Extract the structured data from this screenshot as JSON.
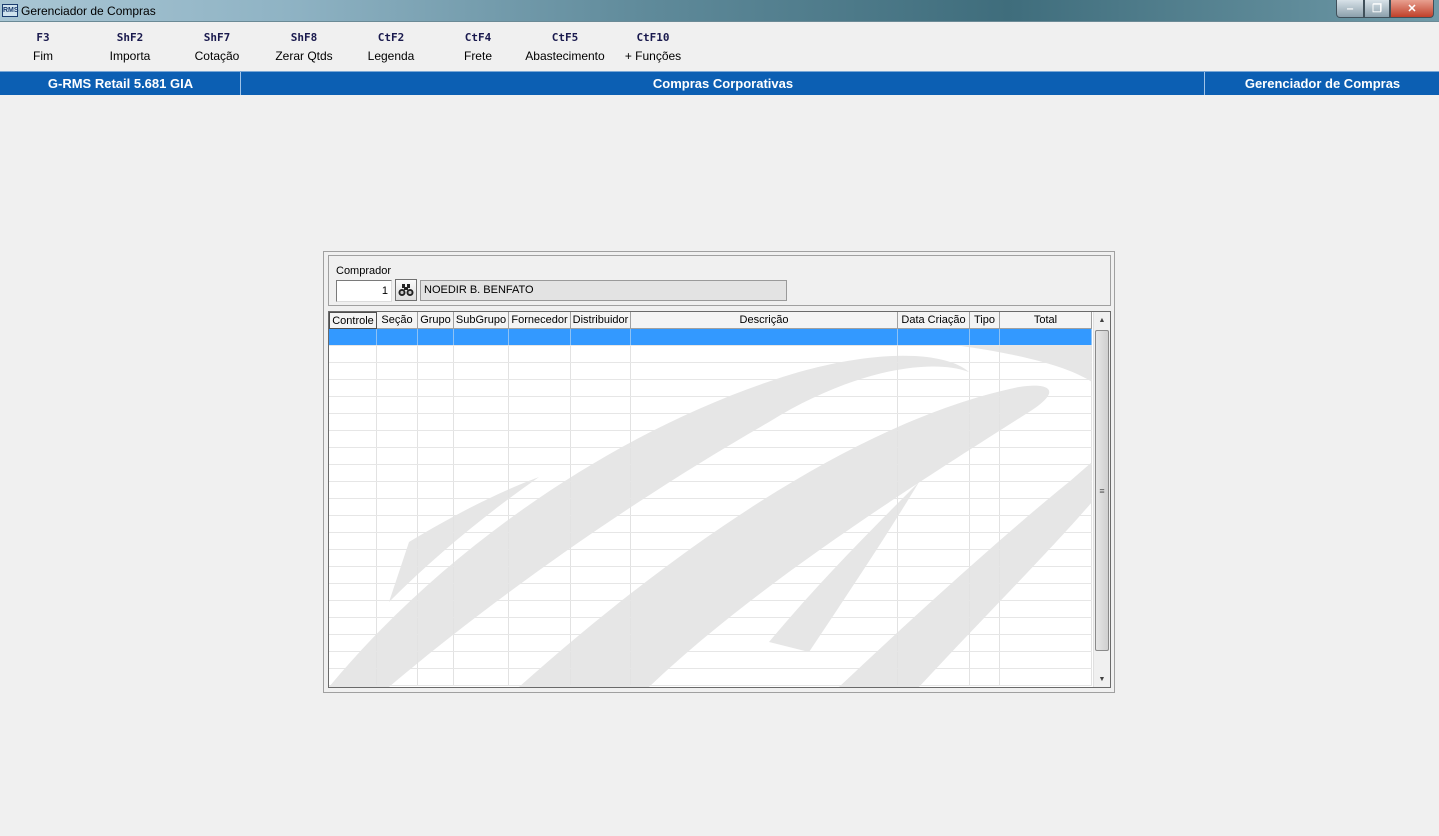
{
  "window": {
    "title": "Gerenciador de Compras",
    "app_icon_text": "RMS",
    "controls": {
      "minimize": "‒",
      "maximize": "❐",
      "close": "✕"
    }
  },
  "toolbar": {
    "keys": [
      {
        "key": "F3",
        "label": "Fim"
      },
      {
        "key": "ShF2",
        "label": "Importa"
      },
      {
        "key": "ShF7",
        "label": "Cotação"
      },
      {
        "key": "ShF8",
        "label": "Zerar Qtds"
      },
      {
        "key": "CtF2",
        "label": "Legenda"
      },
      {
        "key": "CtF4",
        "label": "Frete"
      },
      {
        "key": "CtF5",
        "label": "Abastecimento"
      },
      {
        "key": "CtF10",
        "label": "+ Funções"
      }
    ]
  },
  "infobar": {
    "version": "G-RMS Retail 5.681 GIA",
    "module": "Compras Corporativas",
    "screen": "Gerenciador de Compras"
  },
  "buyer": {
    "label": "Comprador",
    "code": "1",
    "name": "NOEDIR B. BENFATO",
    "search_icon": "binoculars-icon"
  },
  "grid": {
    "columns": [
      "Controle",
      "Seção",
      "Grupo",
      "SubGrupo",
      "Fornecedor",
      "Distribuidor",
      "Descrição",
      "Data Criação",
      "Tipo",
      "Total"
    ],
    "selected_row": 0,
    "row_count": 21,
    "rows": [],
    "colors": {
      "selection": "#3399ff",
      "watermark": "#e6e6e6"
    },
    "scrollbar": {
      "up": "▲",
      "down": "▼",
      "grip": "≡"
    }
  },
  "colors": {
    "infobar": "#0c5fb3",
    "background": "#f0f0f0"
  }
}
